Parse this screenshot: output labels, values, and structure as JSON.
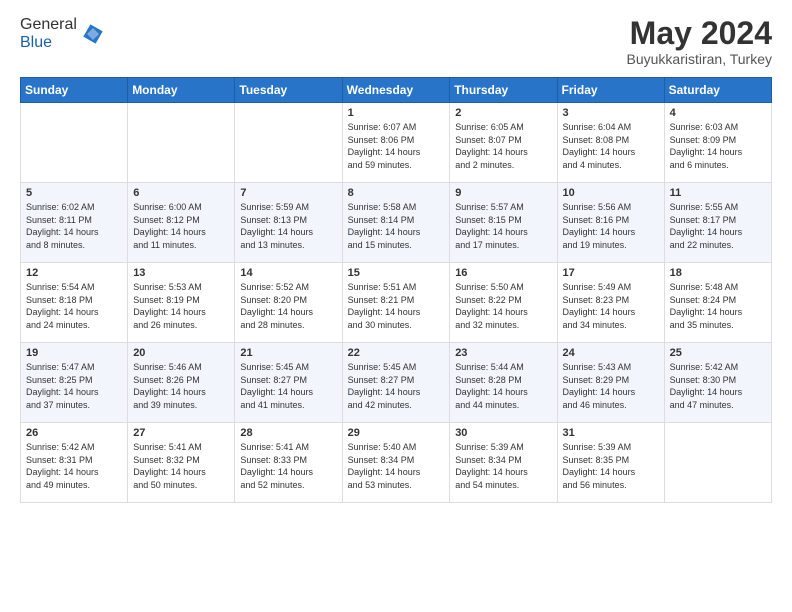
{
  "header": {
    "logo_general": "General",
    "logo_blue": "Blue",
    "month_title": "May 2024",
    "location": "Buyukkaristiran, Turkey"
  },
  "weekdays": [
    "Sunday",
    "Monday",
    "Tuesday",
    "Wednesday",
    "Thursday",
    "Friday",
    "Saturday"
  ],
  "weeks": [
    [
      {
        "day": "",
        "info": ""
      },
      {
        "day": "",
        "info": ""
      },
      {
        "day": "",
        "info": ""
      },
      {
        "day": "1",
        "info": "Sunrise: 6:07 AM\nSunset: 8:06 PM\nDaylight: 14 hours\nand 59 minutes."
      },
      {
        "day": "2",
        "info": "Sunrise: 6:05 AM\nSunset: 8:07 PM\nDaylight: 14 hours\nand 2 minutes."
      },
      {
        "day": "3",
        "info": "Sunrise: 6:04 AM\nSunset: 8:08 PM\nDaylight: 14 hours\nand 4 minutes."
      },
      {
        "day": "4",
        "info": "Sunrise: 6:03 AM\nSunset: 8:09 PM\nDaylight: 14 hours\nand 6 minutes."
      }
    ],
    [
      {
        "day": "5",
        "info": "Sunrise: 6:02 AM\nSunset: 8:11 PM\nDaylight: 14 hours\nand 8 minutes."
      },
      {
        "day": "6",
        "info": "Sunrise: 6:00 AM\nSunset: 8:12 PM\nDaylight: 14 hours\nand 11 minutes."
      },
      {
        "day": "7",
        "info": "Sunrise: 5:59 AM\nSunset: 8:13 PM\nDaylight: 14 hours\nand 13 minutes."
      },
      {
        "day": "8",
        "info": "Sunrise: 5:58 AM\nSunset: 8:14 PM\nDaylight: 14 hours\nand 15 minutes."
      },
      {
        "day": "9",
        "info": "Sunrise: 5:57 AM\nSunset: 8:15 PM\nDaylight: 14 hours\nand 17 minutes."
      },
      {
        "day": "10",
        "info": "Sunrise: 5:56 AM\nSunset: 8:16 PM\nDaylight: 14 hours\nand 19 minutes."
      },
      {
        "day": "11",
        "info": "Sunrise: 5:55 AM\nSunset: 8:17 PM\nDaylight: 14 hours\nand 22 minutes."
      }
    ],
    [
      {
        "day": "12",
        "info": "Sunrise: 5:54 AM\nSunset: 8:18 PM\nDaylight: 14 hours\nand 24 minutes."
      },
      {
        "day": "13",
        "info": "Sunrise: 5:53 AM\nSunset: 8:19 PM\nDaylight: 14 hours\nand 26 minutes."
      },
      {
        "day": "14",
        "info": "Sunrise: 5:52 AM\nSunset: 8:20 PM\nDaylight: 14 hours\nand 28 minutes."
      },
      {
        "day": "15",
        "info": "Sunrise: 5:51 AM\nSunset: 8:21 PM\nDaylight: 14 hours\nand 30 minutes."
      },
      {
        "day": "16",
        "info": "Sunrise: 5:50 AM\nSunset: 8:22 PM\nDaylight: 14 hours\nand 32 minutes."
      },
      {
        "day": "17",
        "info": "Sunrise: 5:49 AM\nSunset: 8:23 PM\nDaylight: 14 hours\nand 34 minutes."
      },
      {
        "day": "18",
        "info": "Sunrise: 5:48 AM\nSunset: 8:24 PM\nDaylight: 14 hours\nand 35 minutes."
      }
    ],
    [
      {
        "day": "19",
        "info": "Sunrise: 5:47 AM\nSunset: 8:25 PM\nDaylight: 14 hours\nand 37 minutes."
      },
      {
        "day": "20",
        "info": "Sunrise: 5:46 AM\nSunset: 8:26 PM\nDaylight: 14 hours\nand 39 minutes."
      },
      {
        "day": "21",
        "info": "Sunrise: 5:45 AM\nSunset: 8:27 PM\nDaylight: 14 hours\nand 41 minutes."
      },
      {
        "day": "22",
        "info": "Sunrise: 5:45 AM\nSunset: 8:27 PM\nDaylight: 14 hours\nand 42 minutes."
      },
      {
        "day": "23",
        "info": "Sunrise: 5:44 AM\nSunset: 8:28 PM\nDaylight: 14 hours\nand 44 minutes."
      },
      {
        "day": "24",
        "info": "Sunrise: 5:43 AM\nSunset: 8:29 PM\nDaylight: 14 hours\nand 46 minutes."
      },
      {
        "day": "25",
        "info": "Sunrise: 5:42 AM\nSunset: 8:30 PM\nDaylight: 14 hours\nand 47 minutes."
      }
    ],
    [
      {
        "day": "26",
        "info": "Sunrise: 5:42 AM\nSunset: 8:31 PM\nDaylight: 14 hours\nand 49 minutes."
      },
      {
        "day": "27",
        "info": "Sunrise: 5:41 AM\nSunset: 8:32 PM\nDaylight: 14 hours\nand 50 minutes."
      },
      {
        "day": "28",
        "info": "Sunrise: 5:41 AM\nSunset: 8:33 PM\nDaylight: 14 hours\nand 52 minutes."
      },
      {
        "day": "29",
        "info": "Sunrise: 5:40 AM\nSunset: 8:34 PM\nDaylight: 14 hours\nand 53 minutes."
      },
      {
        "day": "30",
        "info": "Sunrise: 5:39 AM\nSunset: 8:34 PM\nDaylight: 14 hours\nand 54 minutes."
      },
      {
        "day": "31",
        "info": "Sunrise: 5:39 AM\nSunset: 8:35 PM\nDaylight: 14 hours\nand 56 minutes."
      },
      {
        "day": "",
        "info": ""
      }
    ]
  ]
}
